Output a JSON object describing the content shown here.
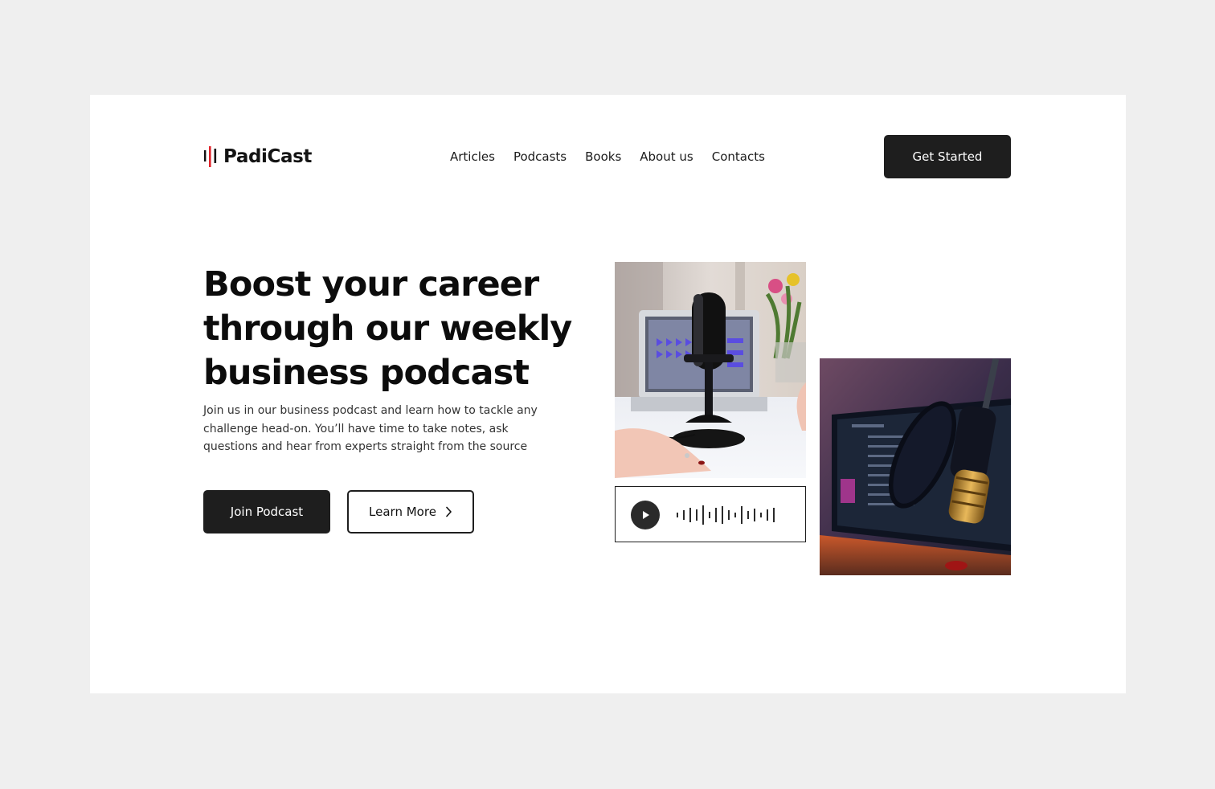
{
  "brand": {
    "name": "PadiCast",
    "mark_color": "#e0242b"
  },
  "nav": {
    "items": [
      {
        "label": "Articles"
      },
      {
        "label": "Podcasts"
      },
      {
        "label": "Books"
      },
      {
        "label": "About us"
      },
      {
        "label": "Contacts"
      }
    ]
  },
  "header": {
    "cta_label": "Get Started"
  },
  "hero": {
    "title": "Boost your career through our weekly business podcast",
    "description": "Join us in our business podcast and learn how to tackle any challenge head-on. You’ll have time to take notes, ask questions and hear from experts straight from the source",
    "primary_label": "Join Podcast",
    "secondary_label": "Learn More"
  },
  "player": {
    "play_icon": "play-icon",
    "waveform_icon": "waveform-icon"
  },
  "colors": {
    "dark": "#1e1e1e",
    "background": "#efefef",
    "card": "#ffffff",
    "accent": "#e0242b"
  }
}
